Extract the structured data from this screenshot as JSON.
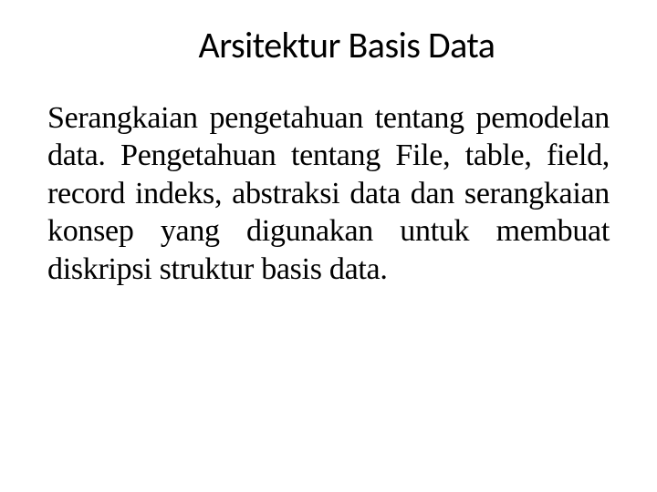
{
  "slide": {
    "title": "Arsitektur Basis Data",
    "body": "Serangkaian pengetahuan tentang pemodelan data. Pengetahuan tentang File, table, field, record indeks, abstraksi data dan serangkaian konsep yang digunakan untuk membuat diskripsi struktur basis data."
  }
}
